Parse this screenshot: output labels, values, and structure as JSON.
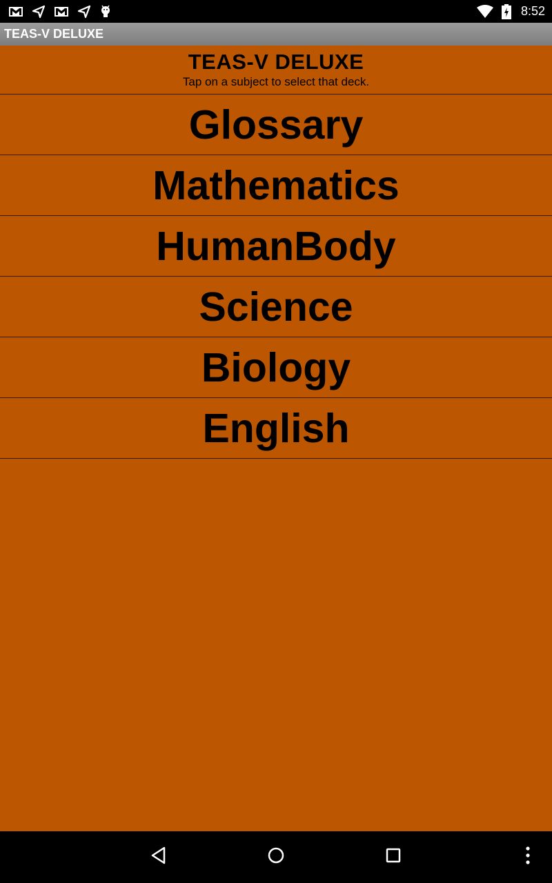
{
  "status_bar": {
    "left_icons": [
      "gmail-icon",
      "send-icon",
      "gmail-icon",
      "send-icon",
      "android-icon"
    ],
    "right_icons": [
      "wifi-icon",
      "battery-charging-icon"
    ],
    "time": "8:52"
  },
  "app_bar": {
    "title": "TEAS-V DELUXE"
  },
  "header": {
    "title": "TEAS-V DELUXE",
    "subtitle": "Tap on a subject to select that deck."
  },
  "decks": [
    {
      "label": "Glossary"
    },
    {
      "label": "Mathematics"
    },
    {
      "label": "HumanBody"
    },
    {
      "label": "Science"
    },
    {
      "label": "Biology"
    },
    {
      "label": "English"
    }
  ],
  "nav_bar": {
    "buttons": [
      "back-icon",
      "home-icon",
      "recents-icon",
      "overflow-menu-icon"
    ]
  },
  "colors": {
    "background": "#bd5600",
    "app_bar": "#8c8c8c",
    "text": "#000000"
  }
}
